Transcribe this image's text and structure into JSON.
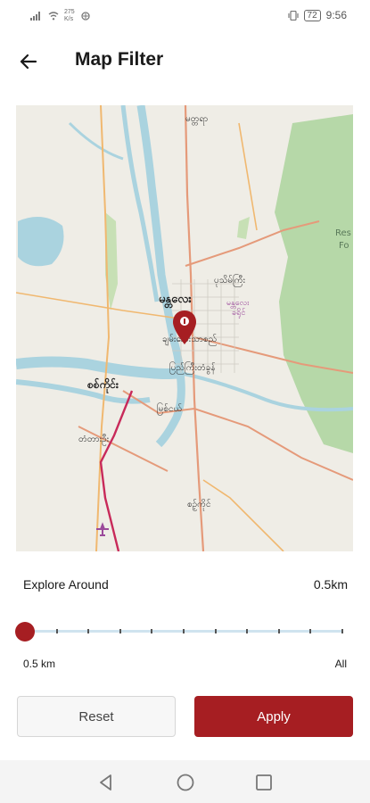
{
  "status_bar": {
    "net_speed_value": "275",
    "net_speed_unit": "K/s",
    "battery": "72",
    "time": "9:56"
  },
  "header": {
    "title": "Map Filter",
    "back_icon": "arrow-left-icon"
  },
  "map": {
    "labels": {
      "city_main": "မန္တလေး",
      "north_town": "မတ္တရာ",
      "northeast_town": "ပုသိမ်ကြီး",
      "east_label": "မန္တလေး\nခရိုင်",
      "center_label": "ချမ်းအေးသာစည်",
      "south_center": "ပြည်ကြီးတံခွန်",
      "west_town": "စစ်ကိုင်း",
      "myitnge": "မြစ်ငယ်",
      "tada_u": "တံတားဦး",
      "south_town": "စဉ့်ကိုင်",
      "forest_1": "Res",
      "forest_2": "Fo"
    },
    "pin_icon": "location-pin-icon",
    "airport_icon": "airplane-icon"
  },
  "filter": {
    "explore_label": "Explore Around",
    "explore_value": "0.5km",
    "slider_value_fraction": 0,
    "min_label": "0.5 km",
    "max_label": "All"
  },
  "buttons": {
    "reset": "Reset",
    "apply": "Apply"
  },
  "colors": {
    "accent": "#a61e22",
    "track": "#cfe3ef"
  }
}
